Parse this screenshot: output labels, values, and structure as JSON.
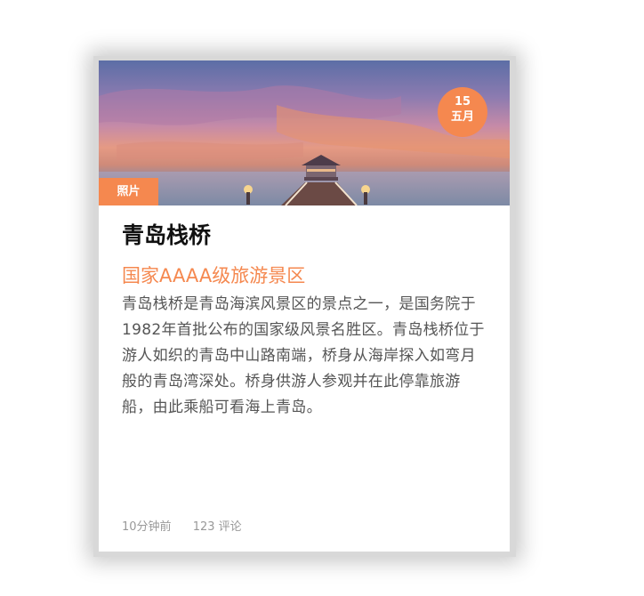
{
  "card": {
    "date": {
      "day": "15",
      "month": "五月"
    },
    "category": "照片",
    "title": "青岛栈桥",
    "subtitle": "国家AAAA级旅游景区",
    "description": "青岛栈桥是青岛海滨风景区的景点之一，是国务院于1982年首批公布的国家级风景名胜区。青岛栈桥位于游人如织的青岛中山路南端，桥身从海岸探入如弯月般的青岛湾深处。桥身供游人参观并在此停靠旅游船，由此乘船可看海上青岛。",
    "meta": {
      "time": "10分钟前",
      "comments": "123 评论"
    }
  },
  "colors": {
    "accent": "#f5884f",
    "title": "#111111",
    "body": "#555555",
    "meta": "#999999"
  }
}
